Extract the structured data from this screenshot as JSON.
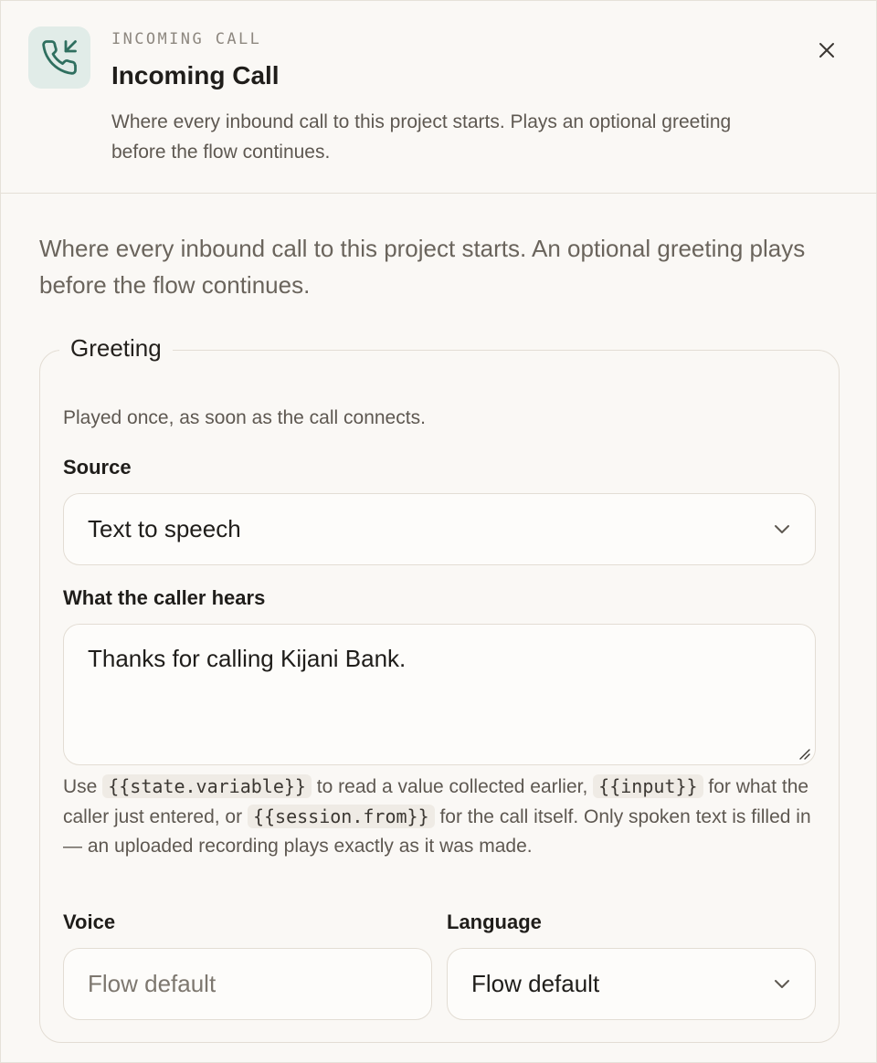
{
  "header": {
    "eyebrow": "INCOMING CALL",
    "title": "Incoming Call",
    "subtitle": "Where every inbound call to this project starts. Plays an optional greeting before the flow continues.",
    "icon": "phone-incoming-icon",
    "close_icon": "close-icon",
    "accent_color": "#2f6f5f"
  },
  "intro": "Where every inbound call to this project starts. An optional greeting plays before the flow continues.",
  "greeting": {
    "legend": "Greeting",
    "help": "Played once, as soon as the call connects.",
    "source": {
      "label": "Source",
      "value": "Text to speech"
    },
    "message": {
      "label": "What the caller hears",
      "value": "Thanks for calling Kijani Bank."
    },
    "hint": {
      "use": "Use",
      "code1": "{{state.variable}}",
      "after1": "to read a value collected earlier,",
      "code2": "{{input}}",
      "after2": "for what the caller just entered, or",
      "code3": "{{session.from}}",
      "after3": "for the call itself. Only spoken text is filled in — an uploaded recording plays exactly as it was made."
    },
    "voice": {
      "label": "Voice",
      "placeholder": "Flow default"
    },
    "language": {
      "label": "Language",
      "value": "Flow default"
    }
  }
}
